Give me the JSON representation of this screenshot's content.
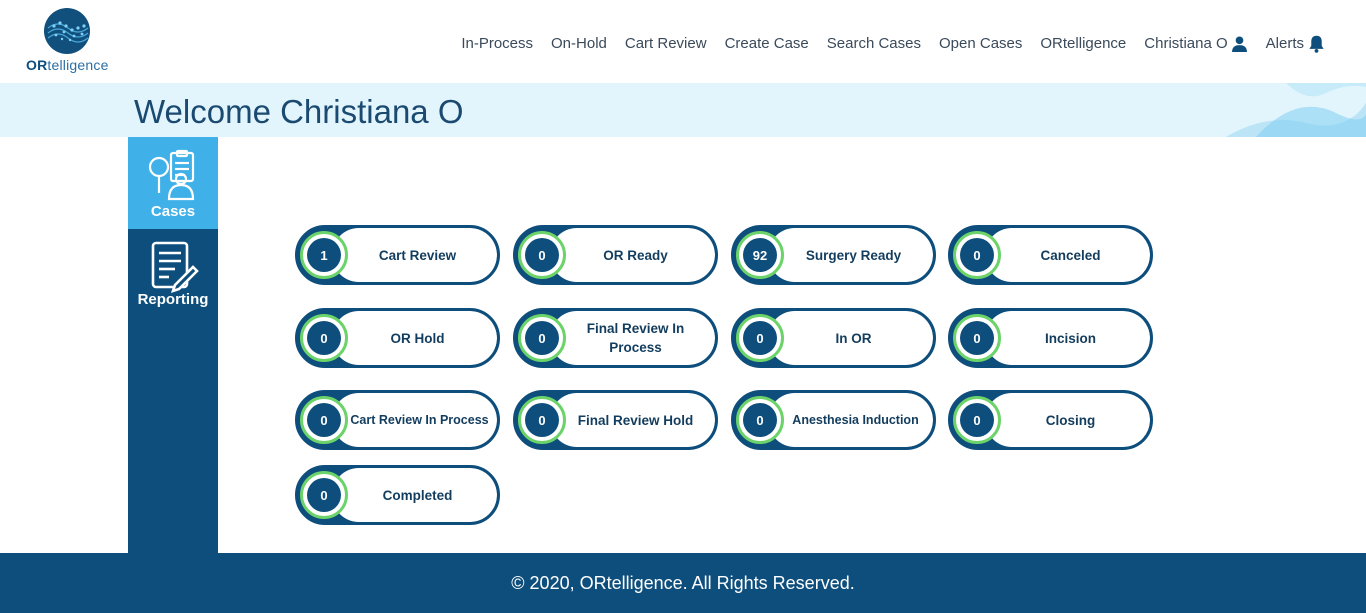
{
  "header": {
    "logo_text_bold": "OR",
    "logo_text_rest": "telligence",
    "nav": [
      {
        "label": "In-Process"
      },
      {
        "label": "On-Hold"
      },
      {
        "label": "Cart Review"
      },
      {
        "label": "Create Case"
      },
      {
        "label": "Search Cases"
      },
      {
        "label": "Open Cases"
      },
      {
        "label": "ORtelligence"
      },
      {
        "label": "Christiana O",
        "icon": "user-icon"
      },
      {
        "label": "Alerts",
        "icon": "bell-icon"
      }
    ]
  },
  "welcome": {
    "title": "Welcome Christiana O"
  },
  "sidebar": {
    "items": [
      {
        "label": "Cases",
        "icon": "cases-icon",
        "active": true
      },
      {
        "label": "Reporting",
        "icon": "report-icon",
        "active": false
      }
    ]
  },
  "tiles": [
    {
      "count": "1",
      "label": "Cart Review"
    },
    {
      "count": "0",
      "label": "OR Ready"
    },
    {
      "count": "92",
      "label": "Surgery Ready"
    },
    {
      "count": "0",
      "label": "Canceled"
    },
    {
      "count": "0",
      "label": "OR Hold"
    },
    {
      "count": "0",
      "label": "Final Review In Process"
    },
    {
      "count": "0",
      "label": "In OR"
    },
    {
      "count": "0",
      "label": "Incision"
    },
    {
      "count": "0",
      "label": "Cart Review In Process"
    },
    {
      "count": "0",
      "label": "Final Review Hold"
    },
    {
      "count": "0",
      "label": "Anesthesia Induction"
    },
    {
      "count": "0",
      "label": "Closing"
    },
    {
      "count": "0",
      "label": "Completed"
    }
  ],
  "footer": {
    "text": "© 2020, ORtelligence. All Rights Reserved."
  },
  "colors": {
    "primary": "#0e4e7c",
    "accent": "#3fb0e8",
    "ring": "#6cd36a",
    "band": "#e3f5fc"
  }
}
